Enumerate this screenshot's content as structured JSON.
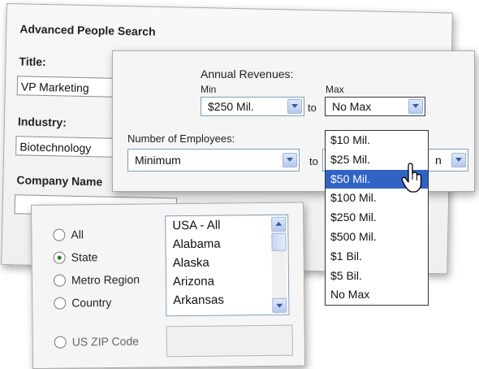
{
  "search_panel": {
    "title": "Advanced People Search",
    "title_label": "Title:",
    "title_value": "VP Marketing",
    "industry_label": "Industry:",
    "industry_value": "Biotechnology",
    "company_label": "Company Name"
  },
  "revenue": {
    "heading": "Annual Revenues:",
    "min_label": "Min",
    "max_label": "Max",
    "min_value": "$250 Mil.",
    "to_label": "to",
    "max_value": "No Max",
    "options": [
      "$10 Mil.",
      "$25 Mil.",
      "$50 Mil.",
      "$100 Mil.",
      "$250 Mil.",
      "$500 Mil.",
      "$1 Bil.",
      "$5 Bil.",
      "No Max"
    ],
    "highlighted_option": "$50 Mil."
  },
  "employees": {
    "label": "Number of Employees:",
    "min_value": "Minimum",
    "to_label": "to",
    "max_value_fragment": "n"
  },
  "location": {
    "radios": [
      {
        "label": "All",
        "selected": false
      },
      {
        "label": "State",
        "selected": true
      },
      {
        "label": "Metro Region",
        "selected": false
      },
      {
        "label": "Country",
        "selected": false
      }
    ],
    "states": [
      "USA - All",
      "Alabama",
      "Alaska",
      "Arizona",
      "Arkansas"
    ],
    "zip_label": "US ZIP Code",
    "zip_value": ""
  },
  "colors": {
    "selection": "#3163c5",
    "radio_dot": "#2a7a2a",
    "control_border": "#7f9db9"
  }
}
